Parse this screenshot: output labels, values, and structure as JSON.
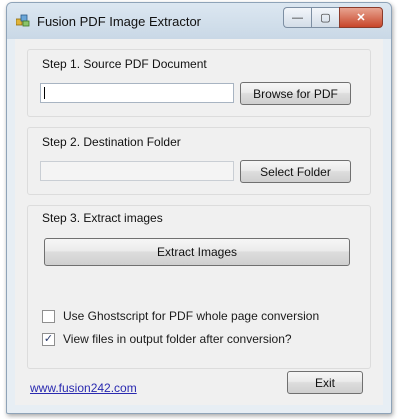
{
  "window": {
    "title": "Fusion PDF Image Extractor",
    "close_glyph": "✕",
    "minimize_glyph": "—",
    "maximize_glyph": "▢"
  },
  "step1": {
    "label": "Step 1.  Source PDF Document",
    "input_value": "",
    "browse_label": "Browse for PDF"
  },
  "step2": {
    "label": "Step 2.  Destination Folder",
    "input_value": "",
    "select_label": "Select Folder"
  },
  "step3": {
    "label": "Step 3.  Extract images",
    "extract_label": "Extract Images"
  },
  "options": {
    "ghostscript_label": "Use Ghostscript for PDF whole page conversion",
    "ghostscript_checked": false,
    "view_files_label": "View files in output folder after conversion?",
    "view_files_checked": true,
    "check_glyph": "✓"
  },
  "footer": {
    "website": "www.fusion242.com",
    "exit_label": "Exit"
  },
  "colors": {
    "close_button": "#c8462a",
    "link": "#2a2ab0"
  }
}
